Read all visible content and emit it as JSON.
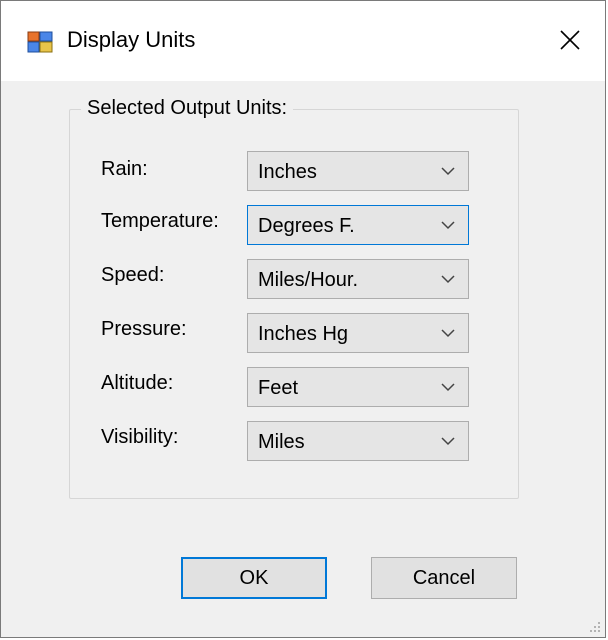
{
  "window": {
    "title": "Display Units",
    "icon": "app-window-icon"
  },
  "group": {
    "legend": "Selected Output Units:"
  },
  "fields": [
    {
      "label": "Rain:",
      "value": "Inches"
    },
    {
      "label": "Temperature:",
      "value": "Degrees F."
    },
    {
      "label": "Speed:",
      "value": "Miles/Hour."
    },
    {
      "label": "Pressure:",
      "value": "Inches Hg"
    },
    {
      "label": "Altitude:",
      "value": "Feet"
    },
    {
      "label": "Visibility:",
      "value": "Miles"
    }
  ],
  "buttons": {
    "ok": "OK",
    "cancel": "Cancel"
  },
  "colors": {
    "accent": "#0078d7",
    "window_bg": "#f0f0f0",
    "titlebar_bg": "#ffffff"
  }
}
